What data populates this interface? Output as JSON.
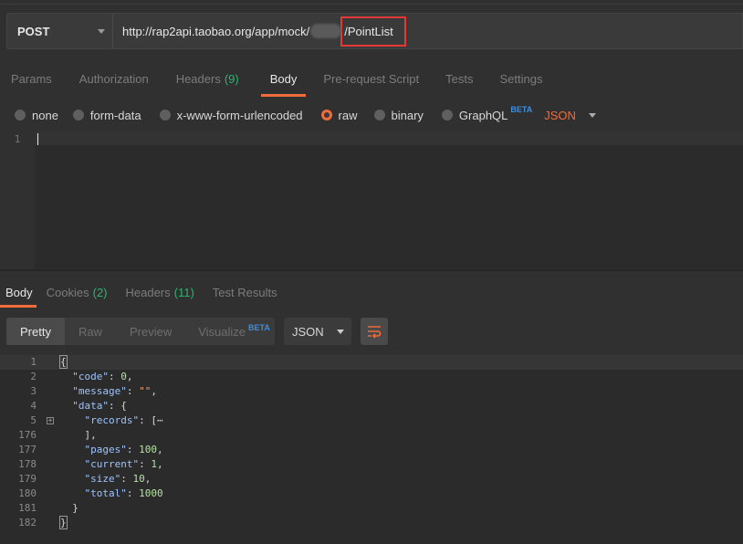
{
  "request": {
    "method": "POST",
    "url_prefix": "http://rap2api.taobao.org/app/mock/",
    "url_suffix": "/PointList"
  },
  "req_tabs": [
    {
      "label": "Params",
      "count": "",
      "active": false
    },
    {
      "label": "Authorization",
      "count": "",
      "active": false
    },
    {
      "label": "Headers",
      "count": "(9)",
      "active": false
    },
    {
      "label": "Body",
      "count": "",
      "active": true
    },
    {
      "label": "Pre-request Script",
      "count": "",
      "active": false
    },
    {
      "label": "Tests",
      "count": "",
      "active": false
    },
    {
      "label": "Settings",
      "count": "",
      "active": false
    }
  ],
  "body_types": {
    "none": "none",
    "form_data": "form-data",
    "urlencoded": "x-www-form-urlencoded",
    "raw": "raw",
    "binary": "binary",
    "graphql": "GraphQL",
    "beta": "BETA",
    "format": "JSON",
    "selected": "raw"
  },
  "editor": {
    "line": "1"
  },
  "res_tabs": {
    "body": "Body",
    "cookies": "Cookies",
    "cookies_count": "(2)",
    "headers": "Headers",
    "headers_count": "(11)",
    "tests": "Test Results"
  },
  "res_toolbar": {
    "pretty": "Pretty",
    "raw": "Raw",
    "preview": "Preview",
    "visualize": "Visualize",
    "beta": "BETA",
    "format": "JSON"
  },
  "response_lines": [
    {
      "n": "1",
      "t": "{"
    },
    {
      "n": "2",
      "t": "  \"code\": 0,"
    },
    {
      "n": "3",
      "t": "  \"message\": \"\","
    },
    {
      "n": "4",
      "t": "  \"data\": {"
    },
    {
      "n": "5",
      "t": "    \"records\": [⋯"
    },
    {
      "n": "176",
      "t": "    ],"
    },
    {
      "n": "177",
      "t": "    \"pages\": 100,"
    },
    {
      "n": "178",
      "t": "    \"current\": 1,"
    },
    {
      "n": "179",
      "t": "    \"size\": 10,"
    },
    {
      "n": "180",
      "t": "    \"total\": 1000"
    },
    {
      "n": "181",
      "t": "  }"
    },
    {
      "n": "182",
      "t": "}"
    }
  ],
  "colors": {
    "accent": "#f26b3a",
    "count": "#2bb673",
    "beta": "#3d8ee0",
    "highlight_box": "#e53935"
  }
}
